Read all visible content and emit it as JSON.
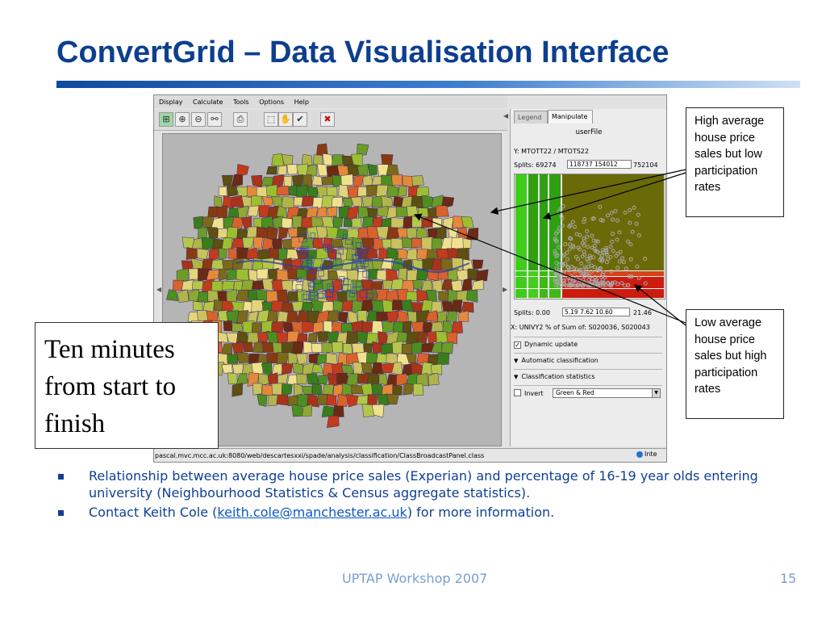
{
  "slide": {
    "title": "ConvertGrid – Data Visualisation Interface",
    "footer": "UPTAP Workshop 2007",
    "page_number": "15"
  },
  "app": {
    "menu": [
      "Display",
      "Calculate",
      "Tools",
      "Options",
      "Help"
    ],
    "toolbar_icons": [
      "zoom-extent-icon",
      "zoom-in-icon",
      "zoom-out-icon",
      "binoculars-icon",
      "print-icon",
      "select-icon",
      "pan-icon",
      "check-icon",
      "close-icon"
    ],
    "tabs": {
      "legend": "Legend",
      "manipulate": "Manipulate"
    },
    "panel_title": "userFile",
    "y_attribute": "Y: MTOTT22 / MTOTS22",
    "y_splits": {
      "label": "Splits: 69274",
      "values": "118737 154012",
      "end": "752104"
    },
    "x_splits": {
      "label": "Splits: 0.00",
      "values": "5.19 7.62 10.60",
      "end": "21.46"
    },
    "x_attribute": "X: UNIVY2 % of Sum of: S020036, S020043",
    "options": {
      "dynamic_update": "Dynamic update",
      "auto_classification": "Automatic classification",
      "classification_statistics": "Classification statistics",
      "invert": "Invert",
      "palette": "Green & Red"
    },
    "status_url": "pascal.mvc.mcc.ac.uk:8080/web/descartesxxi/spade/analysis/classification/ClassBroadcastPanel.class",
    "status_zone": "Inte"
  },
  "callouts": {
    "high": "High average house price sales but low participation rates",
    "low": "Low average house price sales but high participation rates",
    "time": "Ten minutes from start to finish"
  },
  "bullets": [
    "Relationship between average house price sales (Experian) and percentage of 16-19 year olds entering university (Neighbourhood Statistics & Census aggregate statistics).",
    {
      "prefix": "Contact Keith Cole (",
      "email": "keith.cole@manchester.ac.uk",
      "suffix": ") for more information."
    }
  ],
  "colors": {
    "title": "#0d3f8f",
    "bullet_text": "#0f3f95",
    "footer": "#7a9fd0",
    "green": "#3fcc1a",
    "olive": "#6b6a08",
    "red": "#cc1b0f"
  }
}
